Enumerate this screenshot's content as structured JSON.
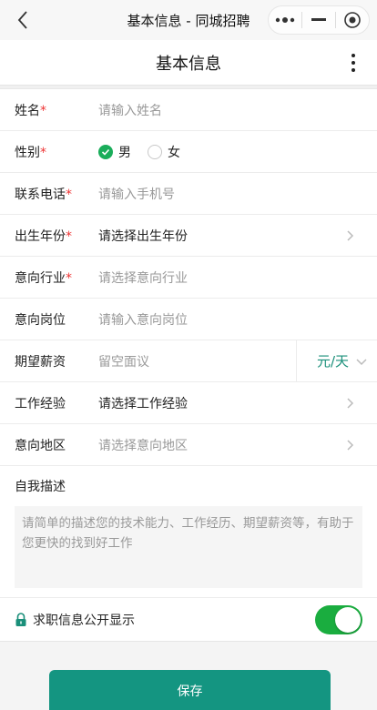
{
  "window": {
    "title": "基本信息 - 同城招聘",
    "icons": [
      "back-arrow-icon",
      "more-dots-icon",
      "minimize-icon",
      "target-close-icon"
    ]
  },
  "navbar": {
    "title": "基本信息",
    "menu_icon": "vertical-dots-icon"
  },
  "form": {
    "name": {
      "label": "姓名",
      "required": "*",
      "placeholder": "请输入姓名"
    },
    "gender": {
      "label": "性别",
      "required": "*",
      "options": [
        "男",
        "女"
      ],
      "selected": "男"
    },
    "phone": {
      "label": "联系电话",
      "required": "*",
      "placeholder": "请输入手机号"
    },
    "birth": {
      "label": "出生年份",
      "required": "*",
      "value": "请选择出生年份"
    },
    "industry": {
      "label": "意向行业",
      "required": "*",
      "placeholder": "请选择意向行业"
    },
    "position": {
      "label": "意向岗位",
      "placeholder": "请输入意向岗位"
    },
    "salary": {
      "label": "期望薪资",
      "placeholder": "留空面议",
      "unit": "元/天"
    },
    "experience": {
      "label": "工作经验",
      "value": "请选择工作经验"
    },
    "region": {
      "label": "意向地区",
      "placeholder": "请选择意向地区"
    },
    "description": {
      "label": "自我描述",
      "placeholder": "请简单的描述您的技术能力、工作经历、期望薪资等，有助于您更快的找到好工作"
    },
    "public": {
      "label": "求职信息公开显示",
      "enabled": true
    }
  },
  "actions": {
    "save_label": "保存"
  },
  "colors": {
    "accent": "#149581",
    "switch_on": "#1aad3f",
    "radio_on": "#1aad5a",
    "required": "#e33333"
  }
}
